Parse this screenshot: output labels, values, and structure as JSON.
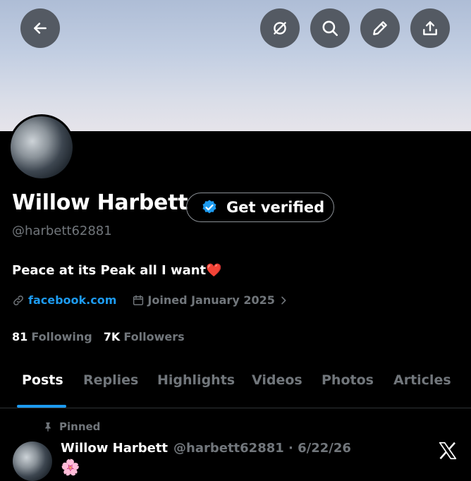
{
  "profile": {
    "name": "Willow Harbett",
    "get_verified_label": "Get verified",
    "handle": "@harbett62881",
    "bio": "Peace at its Peak all I want❤️",
    "link": "facebook.com",
    "joined": "Joined January 2025",
    "following_count": "81",
    "following_label": "Following",
    "followers_count": "7K",
    "followers_label": "Followers"
  },
  "tabs": [
    "Posts",
    "Replies",
    "Highlights",
    "Videos",
    "Photos",
    "Articles"
  ],
  "active_tab": "Posts",
  "post": {
    "pinned_label": "Pinned",
    "name": "Willow Harbett",
    "handle_date": "@harbett62881 · 6/22/26",
    "text": "🌸"
  },
  "icons": {
    "header": [
      "back-arrow-icon",
      "grok-icon",
      "search-icon",
      "edit-pencil-icon",
      "share-icon"
    ],
    "badge": "verified-check-icon",
    "meta": [
      "link-icon",
      "calendar-icon",
      "chevron-right-icon"
    ],
    "pin": "pin-icon",
    "brand": "x-logo-icon"
  },
  "colors": {
    "accent": "#1d9bf0",
    "muted": "#71767b",
    "background": "#000000"
  }
}
